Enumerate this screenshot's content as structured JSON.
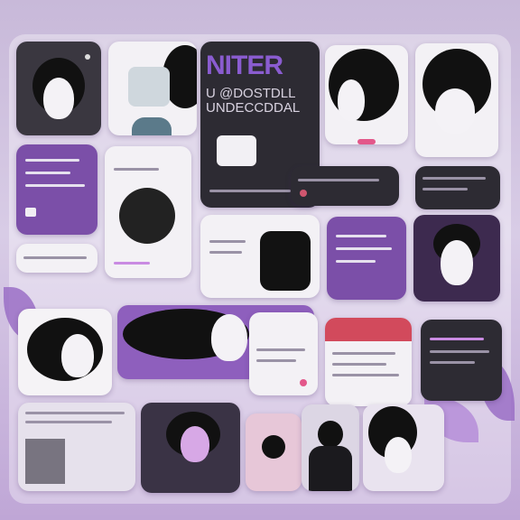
{
  "poster": {
    "headline": "NITER",
    "subline_1": "U @DOSTDLL",
    "subline_2": "UNDECCDDAL"
  },
  "colors": {
    "accent_purple": "#7b4fa8",
    "dark_panel": "#2d2b33",
    "light_panel": "#f3f1f5",
    "hair": "#111111",
    "pink": "#e3578a",
    "background": "#cbbcdc"
  },
  "icons": [
    "portrait-avatar",
    "speech-bubble",
    "globe-icon",
    "camera-icon",
    "document-icon"
  ]
}
